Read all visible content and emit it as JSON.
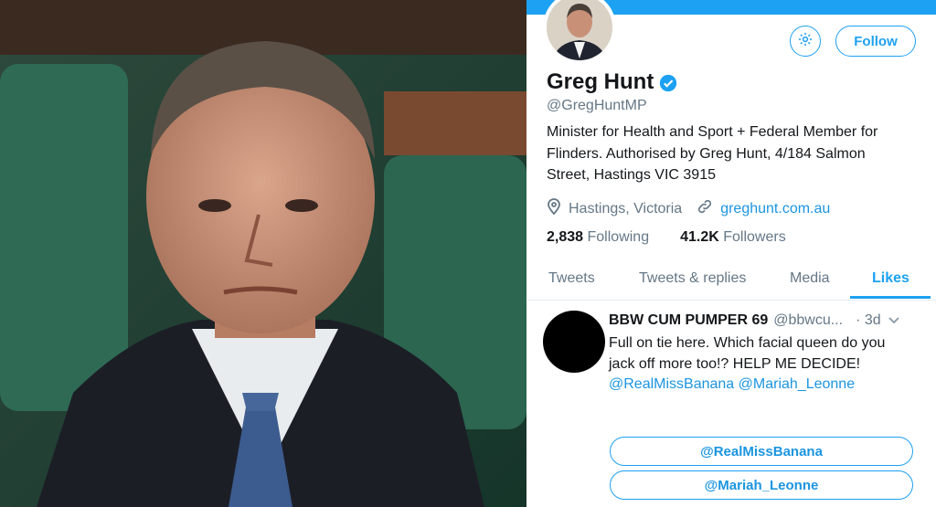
{
  "profile": {
    "name": "Greg Hunt",
    "handle": "@GregHuntMP",
    "bio": "Minister for Health and Sport + Federal Member for Flinders. Authorised by Greg Hunt, 4/184 Salmon Street, Hastings VIC 3915",
    "location": "Hastings, Victoria",
    "website": "greghunt.com.au",
    "following_count": "2,838",
    "following_label": "Following",
    "followers_count": "41.2K",
    "followers_label": "Followers"
  },
  "actions": {
    "follow_label": "Follow",
    "settings_icon": "gear-icon"
  },
  "tabs": [
    {
      "label": "Tweets"
    },
    {
      "label": "Tweets & replies"
    },
    {
      "label": "Media"
    },
    {
      "label": "Likes",
      "active": true
    }
  ],
  "tweet": {
    "author": "BBW CUM PUMPER 69",
    "handle": "@bbwcu...",
    "time": "· 3d",
    "text_plain": "Full on tie here. Which facial queen do you jack off more too!? HELP ME DECIDE!",
    "mention_1": "@RealMissBanana",
    "mention_2": "@Mariah_Leonne",
    "poll_options": [
      "@RealMissBanana",
      "@Mariah_Leonne"
    ]
  },
  "colors": {
    "accent": "#1da1f2",
    "text": "#14171a",
    "muted": "#657786"
  }
}
